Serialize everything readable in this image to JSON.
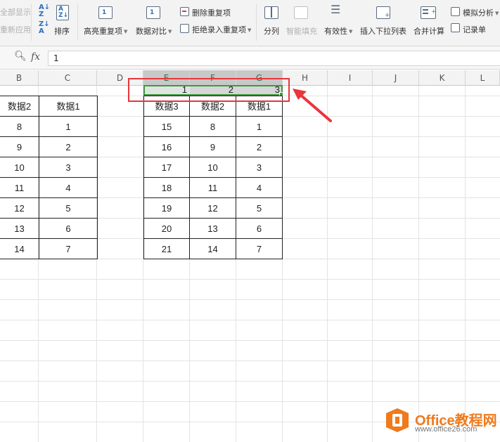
{
  "ribbon": {
    "show_all": "全部显示",
    "reapply": "重新应用",
    "sort": "排序",
    "highlight_dup": "高亮重复项",
    "data_compare": "数据对比",
    "delete_dup": "删除重复项",
    "reject_dup": "拒绝录入重复项",
    "split": "分列",
    "smart_fill": "智能填充",
    "validity": "有效性",
    "insert_dropdown": "插入下拉列表",
    "merge_calc": "合并计算",
    "simulate": "模拟分析",
    "record_sheet": "记录单"
  },
  "formula_bar": {
    "fx": "fx",
    "value": "1"
  },
  "columns": [
    "B",
    "C",
    "D",
    "E",
    "F",
    "G",
    "H",
    "I",
    "J",
    "K",
    "L"
  ],
  "table_left": {
    "headers": [
      "数据2",
      "数据1"
    ],
    "rows": [
      [
        "8",
        "1"
      ],
      [
        "9",
        "2"
      ],
      [
        "10",
        "3"
      ],
      [
        "11",
        "4"
      ],
      [
        "12",
        "5"
      ],
      [
        "13",
        "6"
      ],
      [
        "14",
        "7"
      ]
    ]
  },
  "selected_row": [
    "1",
    "2",
    "3"
  ],
  "table_right": {
    "headers": [
      "数据3",
      "数据2",
      "数据1"
    ],
    "rows": [
      [
        "15",
        "8",
        "1"
      ],
      [
        "16",
        "9",
        "2"
      ],
      [
        "17",
        "10",
        "3"
      ],
      [
        "18",
        "11",
        "4"
      ],
      [
        "19",
        "12",
        "5"
      ],
      [
        "20",
        "13",
        "6"
      ],
      [
        "21",
        "14",
        "7"
      ]
    ]
  },
  "watermark": {
    "name": "Office教程网",
    "url": "www.office26.com"
  },
  "colors": {
    "selection": "#3c9a3c",
    "annotation": "#e8363c",
    "brand": "#f07a1c"
  }
}
